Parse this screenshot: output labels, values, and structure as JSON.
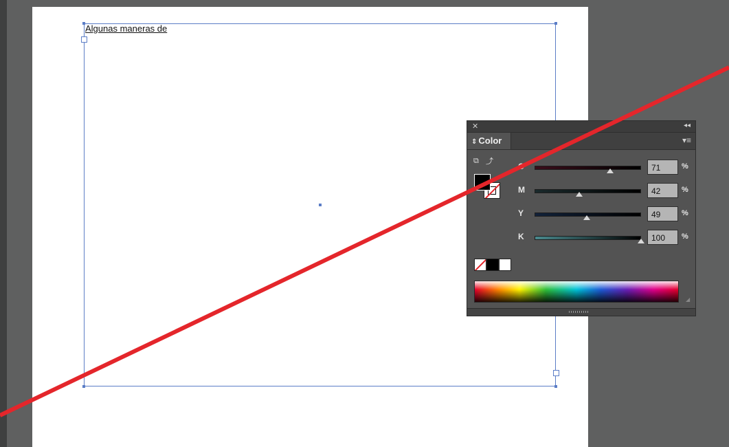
{
  "document": {
    "frame_text": "Algunas maneras de"
  },
  "color_panel": {
    "close_glyph": "✕",
    "collapse_glyph": "◂◂",
    "tab_label": "Color",
    "tab_arrows": "⇕",
    "menu_glyph": "▾≡",
    "channels": [
      {
        "label": "C",
        "value": "71",
        "unit": "%",
        "level": 0.71,
        "track_from": "#3a0e1a",
        "track_to": "#000000"
      },
      {
        "label": "M",
        "value": "42",
        "unit": "%",
        "level": 0.42,
        "track_from": "#1a2a2c",
        "track_to": "#000000"
      },
      {
        "label": "Y",
        "value": "49",
        "unit": "%",
        "level": 0.49,
        "track_from": "#12223a",
        "track_to": "#000000"
      },
      {
        "label": "K",
        "value": "100",
        "unit": "%",
        "level": 1.0,
        "track_from": "#4a8a8e",
        "track_to": "#000000"
      }
    ],
    "icons": {
      "default_fill_stroke": "default-fill-stroke-icon",
      "swap_fill_stroke": "swap-fill-stroke-icon"
    },
    "colors": {
      "accent_selection": "#5b7dc6",
      "annotation_line": "#e4262b",
      "panel_bg": "#535353"
    }
  }
}
